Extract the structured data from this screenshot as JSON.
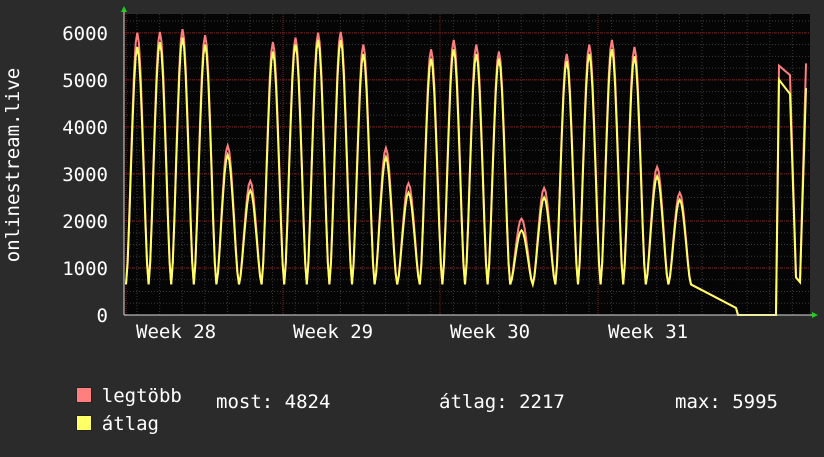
{
  "chart_data": {
    "type": "area",
    "ylabel": "onlinestream.live",
    "xticks": [
      "Week 28",
      "Week 29",
      "Week 30",
      "Week 31"
    ],
    "yticks": [
      0,
      1000,
      2000,
      3000,
      4000,
      5000,
      6000
    ],
    "ylim": [
      0,
      6400
    ],
    "grid": true,
    "colors": {
      "max": "#ff7f7f",
      "avg": "#ffff66",
      "grid": "#7a1f1f",
      "minorgrid": "#3a3a3a",
      "plot_bg": "#050505"
    },
    "days": [
      {
        "max": 6000,
        "avg": 5700
      },
      {
        "max": 6020,
        "avg": 5800
      },
      {
        "max": 6080,
        "avg": 5900
      },
      {
        "max": 5950,
        "avg": 5750
      },
      {
        "max": 3600,
        "avg": 3400
      },
      {
        "max": 2850,
        "avg": 2650
      },
      {
        "max": 5800,
        "avg": 5600
      },
      {
        "max": 5900,
        "avg": 5750
      },
      {
        "max": 6000,
        "avg": 5850
      },
      {
        "max": 6020,
        "avg": 5850
      },
      {
        "max": 5750,
        "avg": 5550
      },
      {
        "max": 3550,
        "avg": 3350
      },
      {
        "max": 2800,
        "avg": 2600
      },
      {
        "max": 5650,
        "avg": 5450
      },
      {
        "max": 5850,
        "avg": 5650
      },
      {
        "max": 5750,
        "avg": 5550
      },
      {
        "max": 5600,
        "avg": 5450
      },
      {
        "max": 2050,
        "avg": 1800
      },
      {
        "max": 2700,
        "avg": 2500
      },
      {
        "max": 5550,
        "avg": 5400
      },
      {
        "max": 5750,
        "avg": 5550
      },
      {
        "max": 5850,
        "avg": 5650
      },
      {
        "max": 5700,
        "avg": 5500
      },
      {
        "max": 3150,
        "avg": 2950
      },
      {
        "max": 2600,
        "avg": 2450
      }
    ],
    "series": [
      {
        "name": "legtöbb",
        "color": "#ff7f7f"
      },
      {
        "name": "átlag",
        "color": "#ffff66"
      }
    ],
    "stats": {
      "most_label": "most:",
      "most": "4824",
      "atlag_label": "átlag:",
      "atlag": "2217",
      "max_label": "max:",
      "max": "5995"
    }
  }
}
